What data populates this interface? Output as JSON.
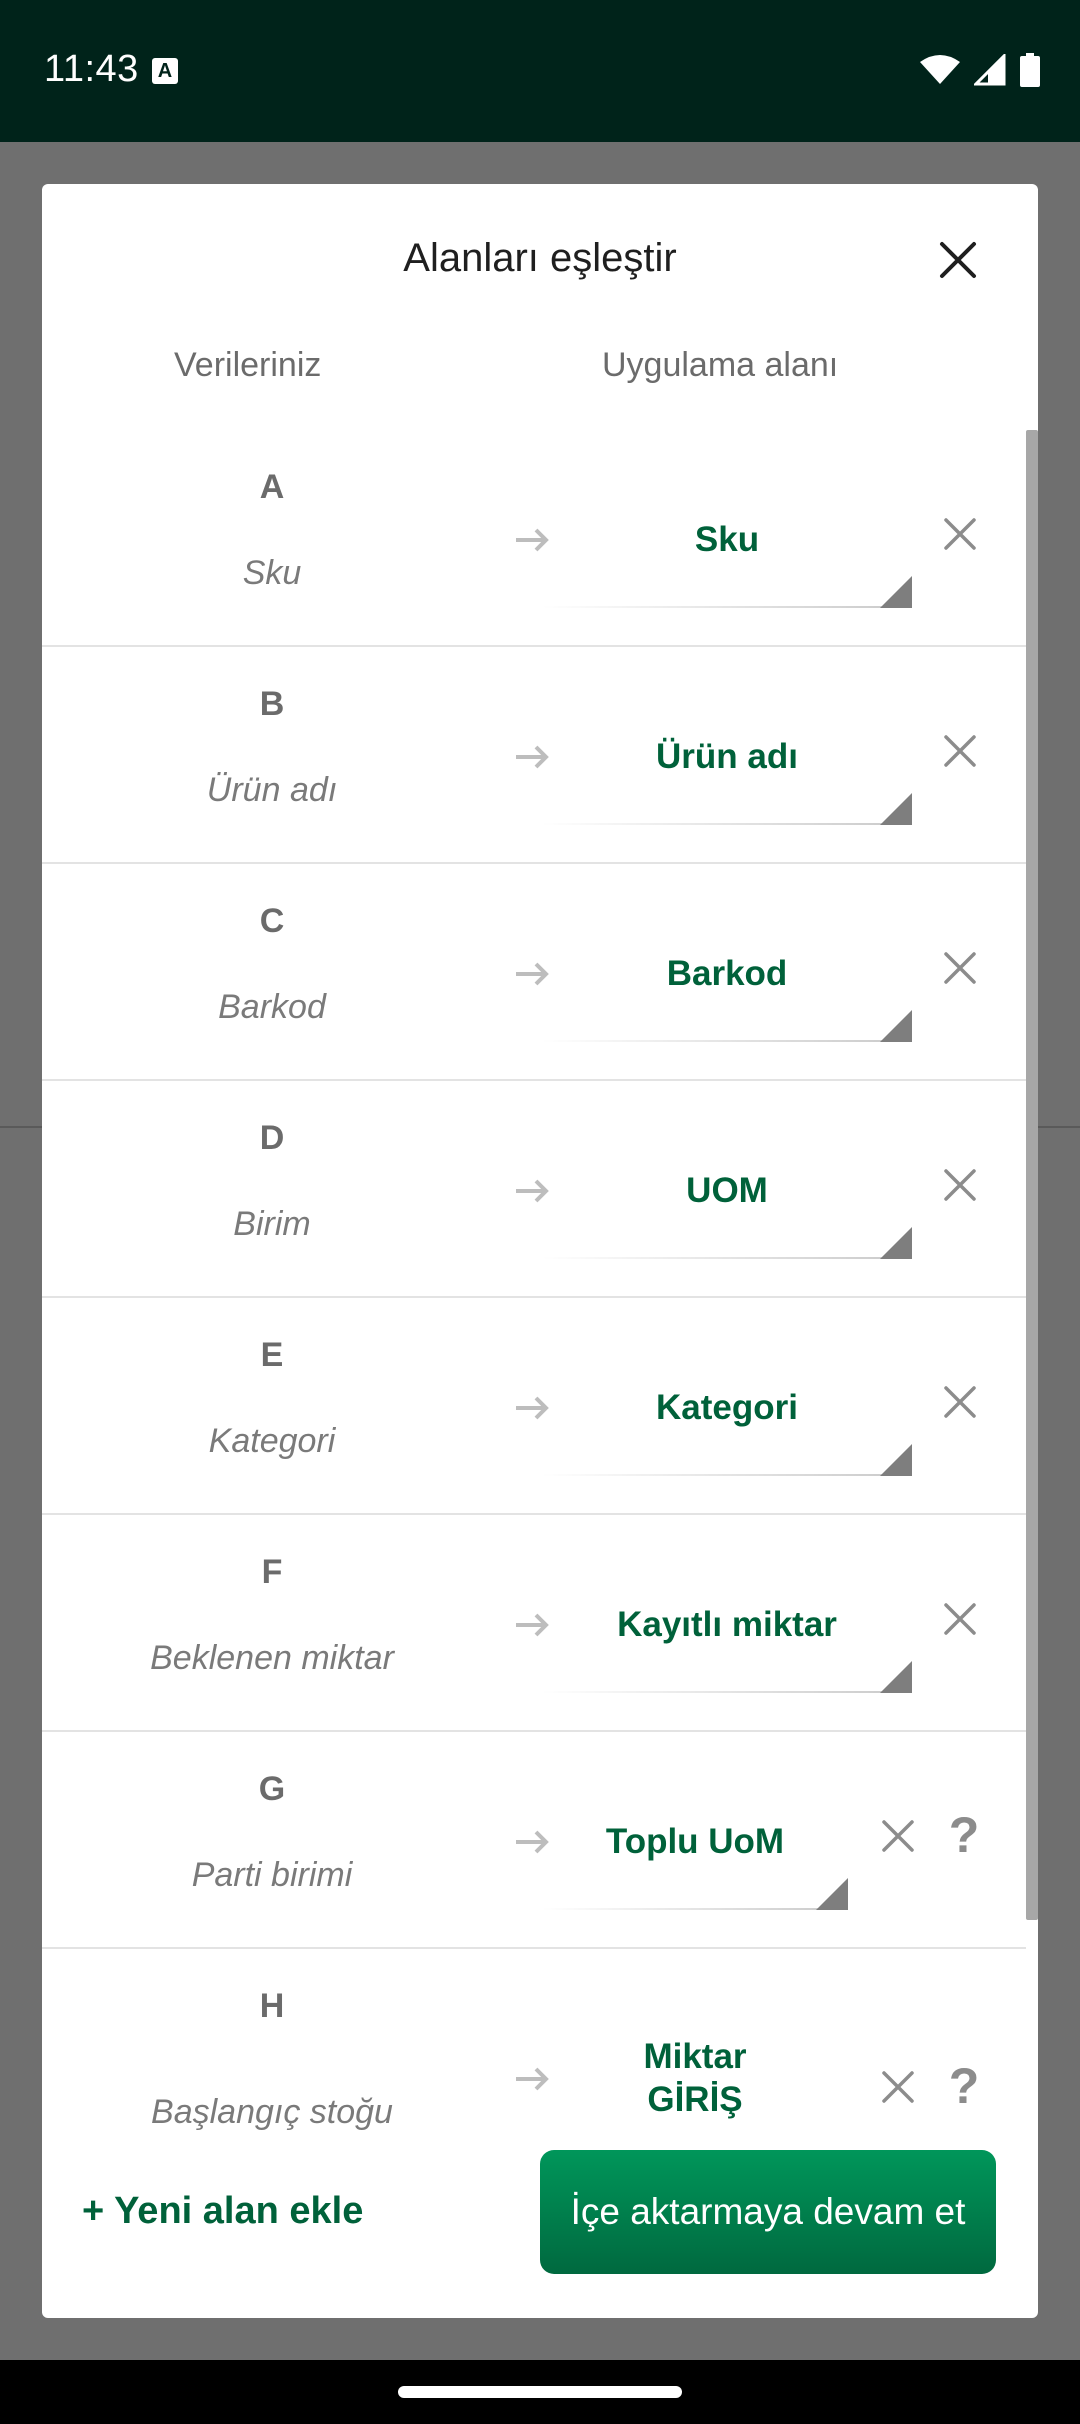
{
  "status_bar": {
    "time": "11:43",
    "notification_icon": "keyboard-a-icon",
    "icons": [
      "wifi-icon",
      "cell-signal-icon",
      "battery-icon"
    ]
  },
  "dialog": {
    "title": "Alanları eşleştir",
    "close_icon": "close-icon",
    "columns": {
      "your_data": "Verileriniz",
      "app_field": "Uygulama alanı"
    },
    "rows": [
      {
        "letter": "A",
        "field": "Sku",
        "mapped": "Sku",
        "help": ""
      },
      {
        "letter": "B",
        "field": "Ürün adı",
        "mapped": "Ürün adı",
        "help": ""
      },
      {
        "letter": "C",
        "field": "Barkod",
        "mapped": "Barkod",
        "help": ""
      },
      {
        "letter": "D",
        "field": "Birim",
        "mapped": "UOM",
        "help": ""
      },
      {
        "letter": "E",
        "field": "Kategori",
        "mapped": "Kategori",
        "help": ""
      },
      {
        "letter": "F",
        "field": "Beklenen miktar",
        "mapped": "Kayıtlı miktar",
        "help": ""
      },
      {
        "letter": "G",
        "field": "Parti birimi",
        "mapped": "Toplu UoM",
        "help": "?"
      },
      {
        "letter": "H",
        "field": "Başlangıç stoğu",
        "mapped": "Miktar GİRİŞ",
        "mapped_line1": "Miktar",
        "mapped_line2": "GİRİŞ",
        "help": "?"
      }
    ],
    "add_field_label": "+ Yeni alan ekle",
    "continue_label": "İçe aktarmaya devam et"
  },
  "colors": {
    "accent": "#00613a",
    "button": "#00804d",
    "status_bar": "#00231a"
  }
}
